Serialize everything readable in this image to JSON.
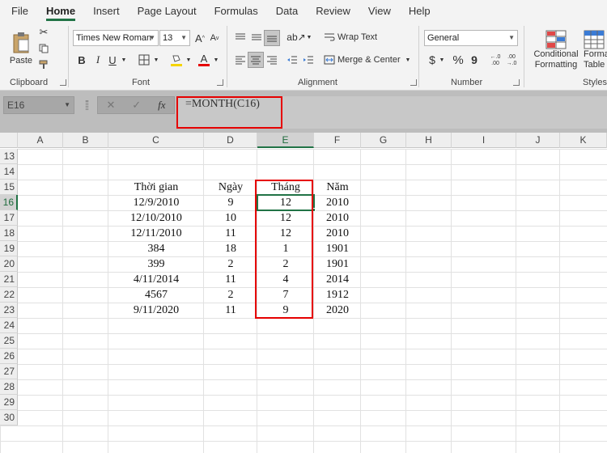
{
  "menu": {
    "tabs": [
      "File",
      "Home",
      "Insert",
      "Page Layout",
      "Formulas",
      "Data",
      "Review",
      "View",
      "Help"
    ],
    "active": "Home"
  },
  "ribbon": {
    "clipboard": {
      "paste_label": "Paste",
      "group_label": "Clipboard"
    },
    "font": {
      "name": "Times New Roman",
      "size": "13",
      "group_label": "Font",
      "bold": "B",
      "italic": "I",
      "underline": "U",
      "font_color": "A",
      "grow": "A",
      "shrink": "A"
    },
    "alignment": {
      "wrap_text": "Wrap Text",
      "merge_center": "Merge & Center",
      "group_label": "Alignment"
    },
    "number": {
      "format": "General",
      "group_label": "Number",
      "currency": "$",
      "percent": "%",
      "comma": "9",
      "inc_decimal": "←.0\n.00",
      "dec_decimal": ".00\n→.0"
    },
    "styles": {
      "conditional_1": "Conditional",
      "conditional_2": "Formatting",
      "format_1": "Forma",
      "format_2": "Table",
      "group_label": "Styles"
    },
    "colors": {
      "accent": "#217346",
      "highlight": "#f5d400",
      "font_color": "#e60000"
    }
  },
  "formula_bar": {
    "name_box": "E16",
    "cancel": "✕",
    "enter": "✓",
    "fx": "fx",
    "formula": "=MONTH(C16)"
  },
  "grid": {
    "columns": [
      "A",
      "B",
      "C",
      "D",
      "E",
      "F",
      "G",
      "H",
      "I",
      "J",
      "K"
    ],
    "selected_column": "E",
    "rows": [
      "13",
      "14",
      "15",
      "16",
      "17",
      "18",
      "19",
      "20",
      "21",
      "22",
      "23",
      "24",
      "25",
      "26",
      "27",
      "28",
      "29",
      "30"
    ],
    "selected_row": "16",
    "header_row": {
      "C": "Thời gian",
      "D": "Ngày",
      "E": "Tháng",
      "F": "Năm"
    },
    "data": [
      {
        "C": "12/9/2010",
        "D": "9",
        "E": "12",
        "F": "2010"
      },
      {
        "C": "12/10/2010",
        "D": "10",
        "E": "12",
        "F": "2010"
      },
      {
        "C": "12/11/2010",
        "D": "11",
        "E": "12",
        "F": "2010"
      },
      {
        "C": "384",
        "D": "18",
        "E": "1",
        "F": "1901"
      },
      {
        "C": "399",
        "D": "2",
        "E": "2",
        "F": "1901"
      },
      {
        "C": "4/11/2014",
        "D": "11",
        "E": "4",
        "F": "2014"
      },
      {
        "C": "4567",
        "D": "2",
        "E": "7",
        "F": "1912"
      },
      {
        "C": "9/11/2020",
        "D": "11",
        "E": "9",
        "F": "2020"
      }
    ],
    "annotation_color": "#e60000"
  }
}
